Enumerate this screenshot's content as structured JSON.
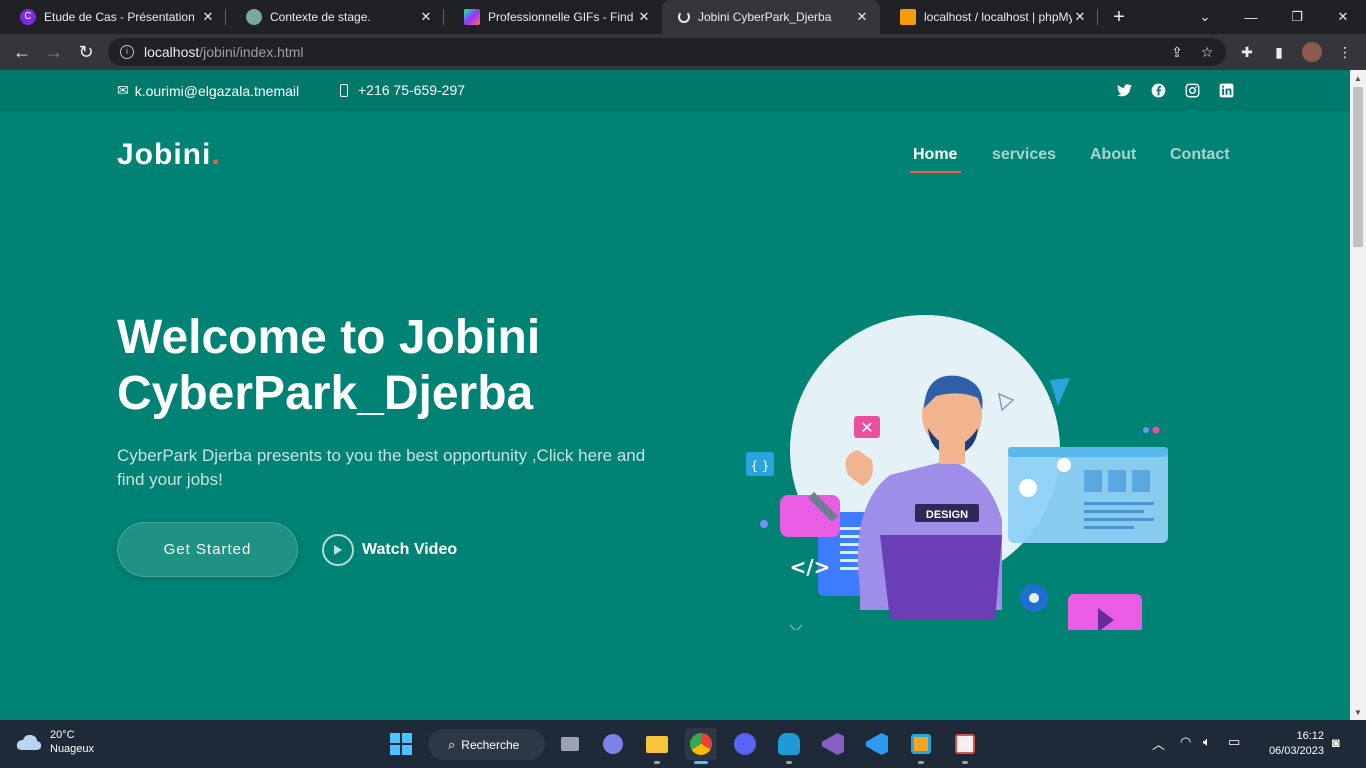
{
  "browser": {
    "tabs": [
      {
        "title": "Etude de Cas - Présentation",
        "icon": "canva-icon",
        "color": "#7d2ae8"
      },
      {
        "title": "Contexte de stage.",
        "icon": "chatgpt-icon",
        "color": "#74aa9c"
      },
      {
        "title": "Professionnelle GIFs - Find &",
        "icon": "giphy-icon",
        "color": "#ffffff"
      },
      {
        "title": "Jobini CyberPark_Djerba",
        "icon": "loading-icon",
        "color": "#e8eaed"
      },
      {
        "title": "localhost / localhost | phpMy",
        "icon": "phpmyadmin-icon",
        "color": "#f89c0e"
      }
    ],
    "active_tab": 3,
    "url_host": "localhost",
    "url_path": "/jobini/index.html"
  },
  "page": {
    "topbar": {
      "email": "k.ourimi@elgazala.tnemail",
      "phone": "+216 75-659-297"
    },
    "logo": {
      "text": "Jobini",
      "dot": "."
    },
    "nav": {
      "home": "Home",
      "services": "services",
      "about": "About",
      "contact": "Contact"
    },
    "hero": {
      "title_line1": "Welcome to Jobini",
      "title_line2": "CyberPark_Djerba",
      "subtitle": "CyberPark Djerba presents to you the best opportunity ,Click here and find your jobs!",
      "cta_primary": "Get Started",
      "cta_secondary": "Watch Video"
    },
    "illustration": {
      "shirt_label": "DESIGN"
    },
    "colors": {
      "background": "#008374",
      "topbar": "#00796b",
      "accent": "#f85a40"
    }
  },
  "taskbar": {
    "weather_temp": "20°C",
    "weather_desc": "Nuageux",
    "search_label": "Recherche",
    "time": "16:12",
    "date": "06/03/2023"
  }
}
